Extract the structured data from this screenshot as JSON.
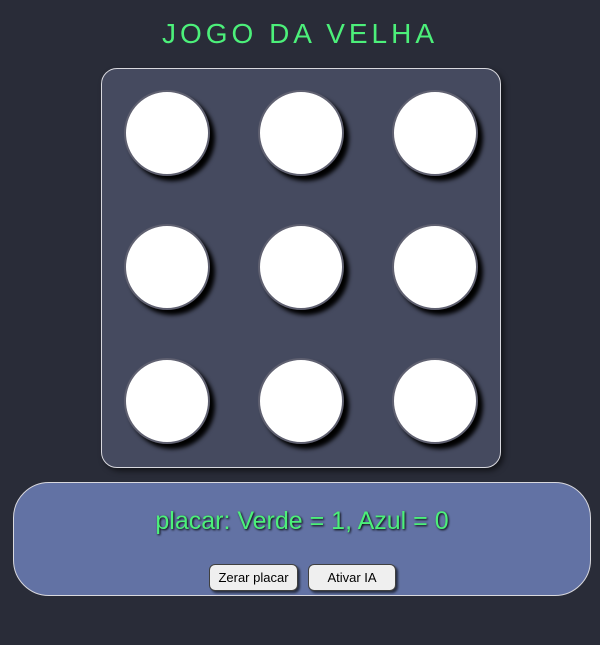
{
  "app": {
    "title": "JOGO DA VELHA"
  },
  "board": {
    "cells": [
      "",
      "",
      "",
      "",
      "",
      "",
      "",
      "",
      ""
    ]
  },
  "score": {
    "text": "placar: Verde = 1, Azul = 0"
  },
  "controls": {
    "reset_label": "Zerar placar",
    "ai_label": "Ativar IA"
  },
  "colors": {
    "background": "#292c38",
    "board": "#454a5f",
    "panel": "#6272a4",
    "accent_green": "#4cf07a",
    "cell": "#ffffff"
  }
}
